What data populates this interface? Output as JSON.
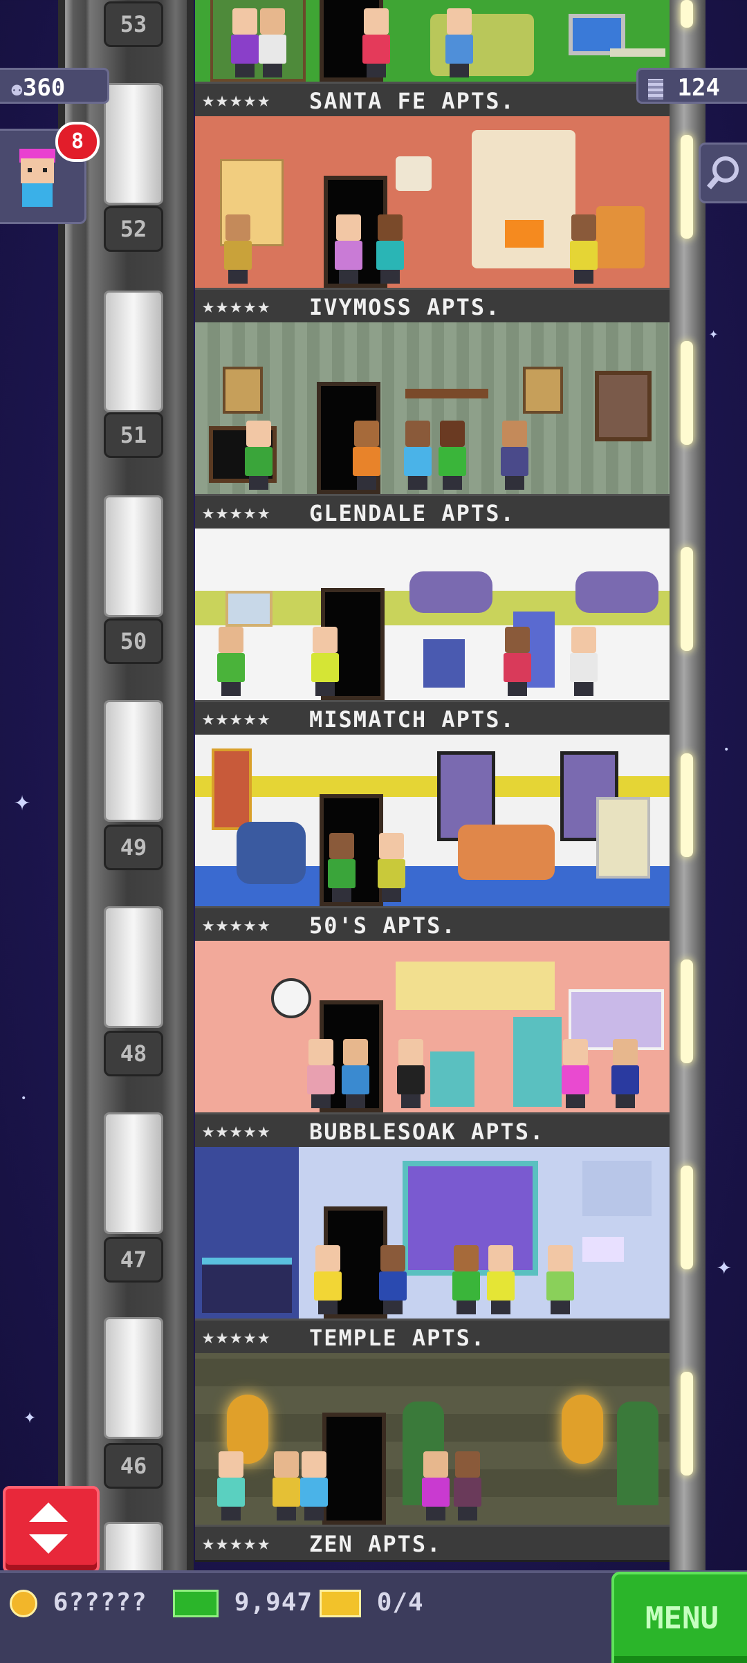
{
  "header": {
    "population": "360",
    "floor_count": "124",
    "visitor_badge": "8"
  },
  "icons": {
    "population": "person-icon",
    "floors": "building-icon",
    "search": "magnifier-icon",
    "elevator": "up-down-arrows-icon",
    "coins": "coin-icon",
    "bux": "cash-icon",
    "tickets": "ticket-icon"
  },
  "floors": [
    {
      "number": "53",
      "name": "SANTA FE APTS.",
      "stars": "★★★★★",
      "wall": "#3fa534"
    },
    {
      "number": "52",
      "name": "IVYMOSS APTS.",
      "stars": "★★★★★",
      "wall": "#d9755c"
    },
    {
      "number": "51",
      "name": "GLENDALE APTS.",
      "stars": "★★★★★",
      "wall": "#8ea08a"
    },
    {
      "number": "50",
      "name": "MISMATCH APTS.",
      "stars": "★★★★★",
      "wall": "#c9d35b"
    },
    {
      "number": "49",
      "name": "50'S APTS.",
      "stars": "★★★★★",
      "wall": "#f2f2f2"
    },
    {
      "number": "48",
      "name": "BUBBLESOAK APTS.",
      "stars": "★★★★★",
      "wall": "#f2a99a"
    },
    {
      "number": "47",
      "name": "TEMPLE APTS.",
      "stars": "★★★★★",
      "wall": "#9fb0e6"
    },
    {
      "number": "46",
      "name": "ZEN APTS.",
      "stars": "★★★★★",
      "wall": "#5a5b45"
    }
  ],
  "footer": {
    "coins": "6?????",
    "bux": "9,947",
    "tickets": "0/4",
    "menu_label": "MENU"
  },
  "colors": {
    "menu_green": "#2bb52a",
    "alert_red": "#e21d2a",
    "elevator_red": "#e8283a"
  }
}
